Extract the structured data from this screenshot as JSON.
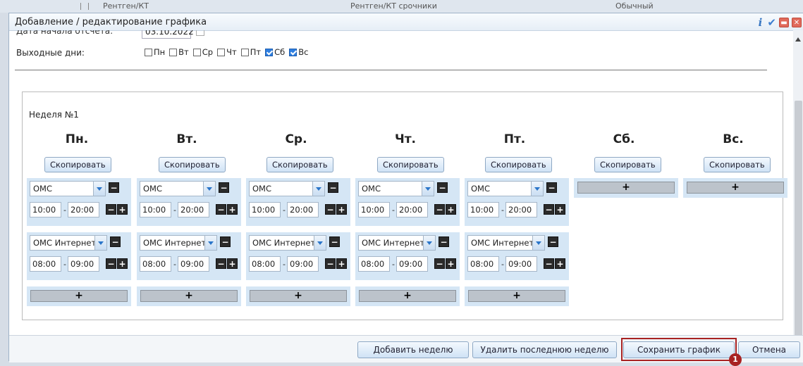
{
  "background_row": {
    "col1": "Рентген/КТ",
    "col2": "Рентген/КТ срочники",
    "col3": "Обычный"
  },
  "window": {
    "title": "Добавление / редактирование графика",
    "info_icon": "i"
  },
  "form": {
    "start_date_label": "Дата начала отсчета:",
    "start_date_value": "03.10.2022",
    "weekend_label": "Выходные дни:",
    "weekend_days": [
      {
        "label": "Пн",
        "checked": false
      },
      {
        "label": "Вт",
        "checked": false
      },
      {
        "label": "Ср",
        "checked": false
      },
      {
        "label": "Чт",
        "checked": false
      },
      {
        "label": "Пт",
        "checked": false
      },
      {
        "label": "Сб",
        "checked": true
      },
      {
        "label": "Вс",
        "checked": true
      }
    ]
  },
  "week": {
    "label": "Неделя №1",
    "copy_label": "Скопировать",
    "add_symbol": "+",
    "remove_symbol": "−",
    "days": [
      {
        "name": "Пн.",
        "slots": [
          {
            "type": "ОМС",
            "from": "10:00",
            "to": "20:00"
          },
          {
            "type": "ОМС Интернет",
            "from": "08:00",
            "to": "09:00"
          }
        ]
      },
      {
        "name": "Вт.",
        "slots": [
          {
            "type": "ОМС",
            "from": "10:00",
            "to": "20:00"
          },
          {
            "type": "ОМС Интернет",
            "from": "08:00",
            "to": "09:00"
          }
        ]
      },
      {
        "name": "Ср.",
        "slots": [
          {
            "type": "ОМС",
            "from": "10:00",
            "to": "20:00"
          },
          {
            "type": "ОМС Интернет",
            "from": "08:00",
            "to": "09:00"
          }
        ]
      },
      {
        "name": "Чт.",
        "slots": [
          {
            "type": "ОМС",
            "from": "10:00",
            "to": "20:00"
          },
          {
            "type": "ОМС Интернет",
            "from": "08:00",
            "to": "09:00"
          }
        ]
      },
      {
        "name": "Пт.",
        "slots": [
          {
            "type": "ОМС",
            "from": "10:00",
            "to": "20:00"
          },
          {
            "type": "ОМС Интернет",
            "from": "08:00",
            "to": "09:00"
          }
        ]
      },
      {
        "name": "Сб.",
        "slots": []
      },
      {
        "name": "Вс.",
        "slots": []
      }
    ]
  },
  "footer": {
    "add_week": "Добавить неделю",
    "delete_last_week": "Удалить последнюю неделю",
    "save": "Сохранить график",
    "cancel": "Отмена",
    "badge": "1"
  },
  "colors": {
    "accent": "#2f7fe0",
    "highlight": "#a82222",
    "slot_bg": "#d5e6f5"
  }
}
